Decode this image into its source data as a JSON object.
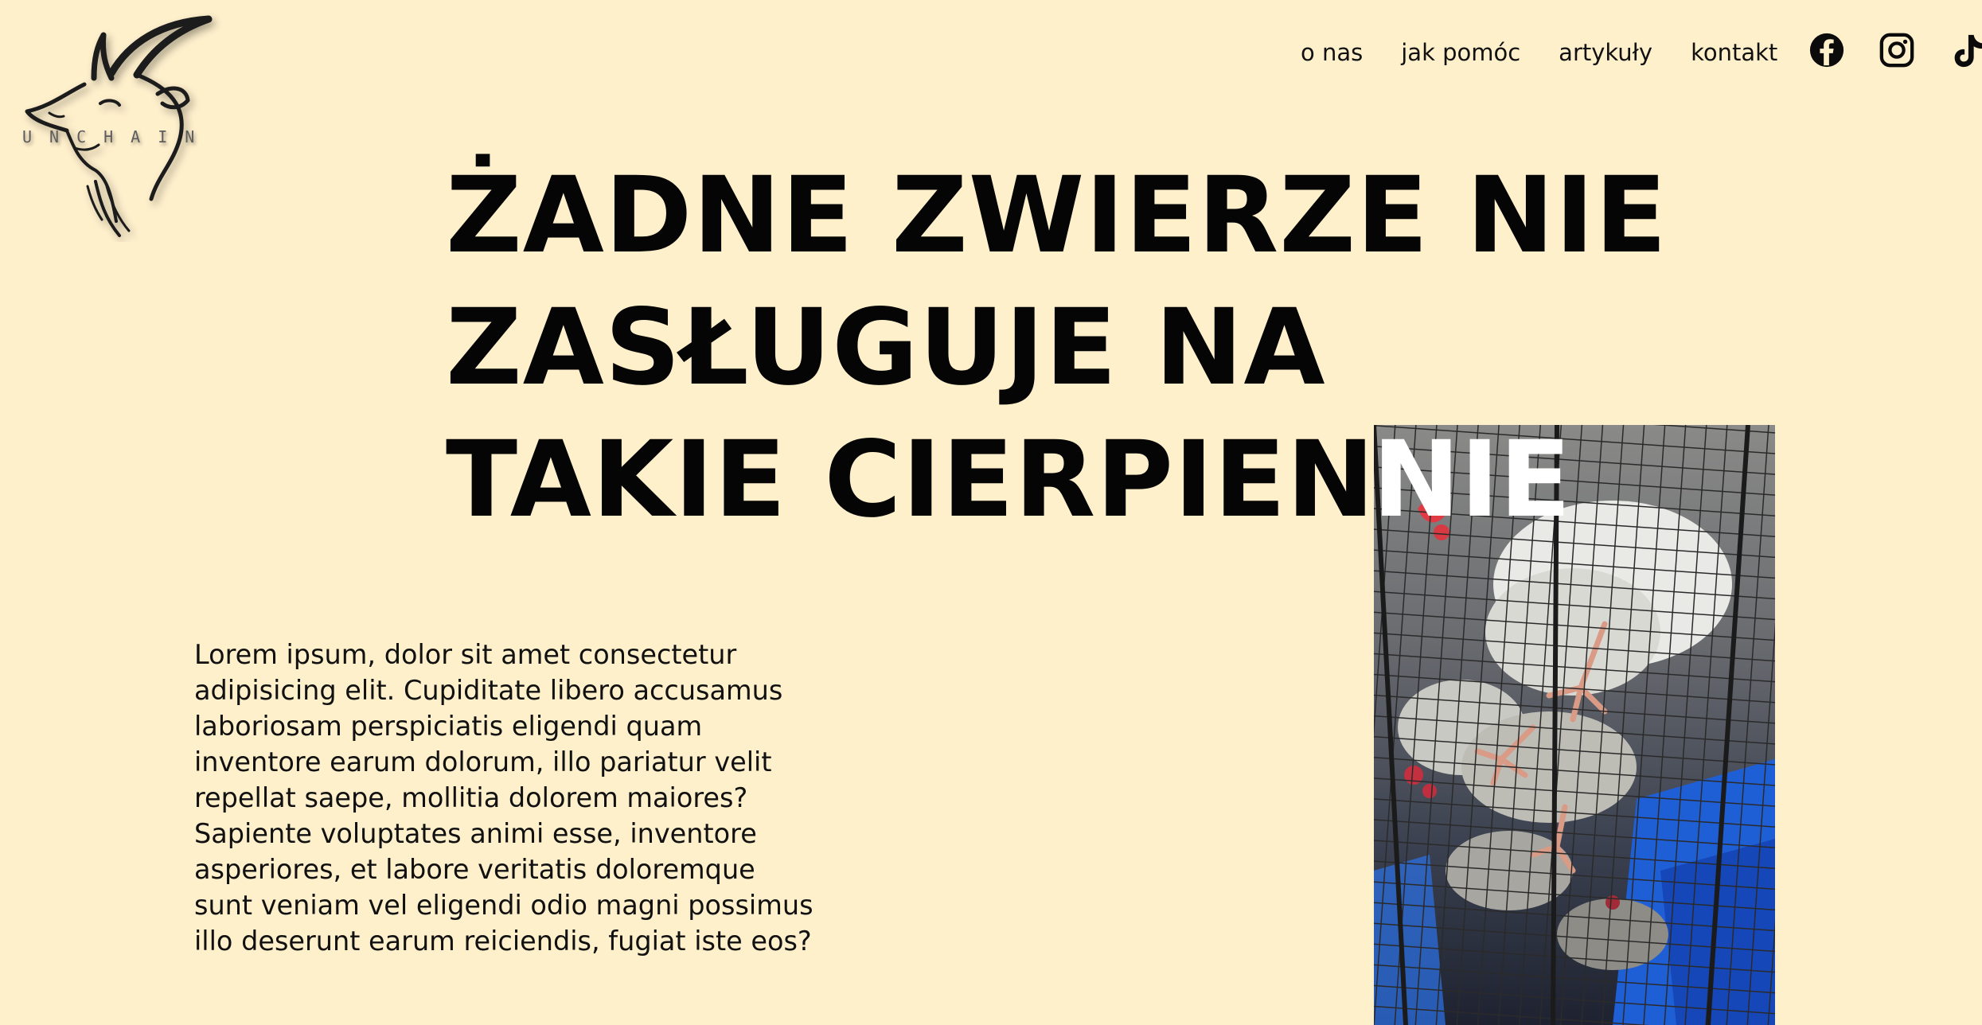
{
  "logo": {
    "text": "UNCHAIN",
    "icon": "goat-head-icon"
  },
  "nav": {
    "items": [
      {
        "label": "o nas"
      },
      {
        "label": "jak pomóc"
      },
      {
        "label": "artykuły"
      },
      {
        "label": "kontakt"
      }
    ],
    "social": [
      {
        "icon": "facebook-icon"
      },
      {
        "icon": "instagram-icon"
      },
      {
        "icon": "tiktok-icon"
      }
    ]
  },
  "hero": {
    "headline_lines": [
      "ŻADNE ZWIERZE NIE",
      "ZASŁUGUJE NA",
      "TAKIE CIERPIENIE"
    ],
    "overlay_word": "NIE",
    "image": "caged-hens-photo",
    "lead": "Lorem ipsum, dolor sit amet consectetur adipisicing elit. Cupiditate libero accusamus laboriosam perspiciatis eligendi quam inventore earum dolorum, illo pariatur velit repellat saepe, mollitia dolorem maiores? Sapiente voluptates animi esse, inventore asperiores, et labore veritatis doloremque sunt veniam vel eligendi odio magni possimus illo deserunt earum reiciendis, fugiat iste eos?"
  },
  "colors": {
    "background": "#fff0cc",
    "text": "#0b0b0b",
    "overlay_text": "#ffffff"
  }
}
